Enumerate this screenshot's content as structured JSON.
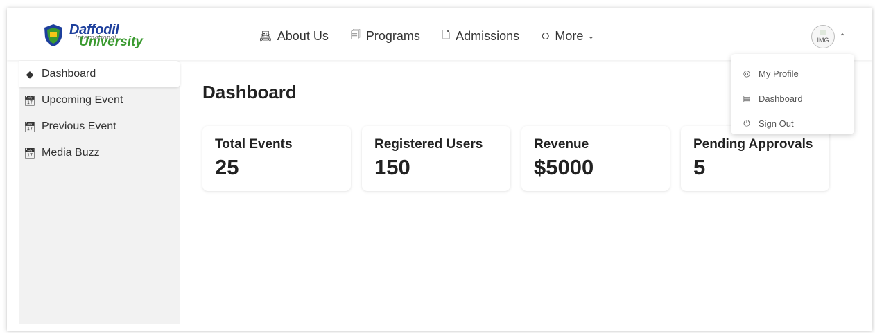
{
  "brand": {
    "title": "Daffodil",
    "subtitle_script": "International",
    "subtitle": "University",
    "colors": {
      "blue": "#1d3f9c",
      "green": "#3a9a2f"
    }
  },
  "nav": {
    "items": [
      {
        "label": "About Us",
        "icon": "id-card-icon"
      },
      {
        "label": "Programs",
        "icon": "document-stack-icon"
      },
      {
        "label": "Admissions",
        "icon": "file-icon"
      },
      {
        "label": "More",
        "icon": "layers-icon",
        "has_dropdown": true
      }
    ]
  },
  "user": {
    "avatar_alt": "IMG",
    "menu_open": true,
    "menu": [
      {
        "label": "My Profile",
        "icon": "user-circle-icon"
      },
      {
        "label": "Dashboard",
        "icon": "table-icon"
      },
      {
        "label": "Sign Out",
        "icon": "power-icon"
      }
    ]
  },
  "sidebar": {
    "items": [
      {
        "label": "Dashboard",
        "icon": "layers-icon",
        "active": true
      },
      {
        "label": "Upcoming Event",
        "icon": "calendar-icon"
      },
      {
        "label": "Previous Event",
        "icon": "calendar-icon"
      },
      {
        "label": "Media Buzz",
        "icon": "calendar-icon"
      }
    ]
  },
  "main": {
    "title": "Dashboard",
    "stats": [
      {
        "label": "Total Events",
        "value": "25"
      },
      {
        "label": "Registered Users",
        "value": "150"
      },
      {
        "label": "Revenue",
        "value": "$5000"
      },
      {
        "label": "Pending Approvals",
        "value": "5"
      }
    ]
  }
}
